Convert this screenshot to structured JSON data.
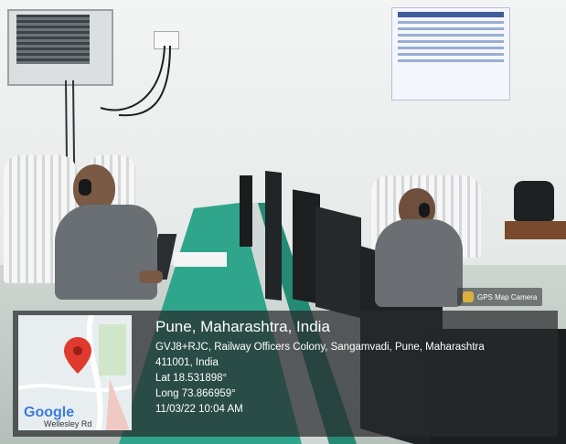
{
  "badge": {
    "label": "GPS Map Camera"
  },
  "map": {
    "brand": "Google",
    "road_label": "Wellesley Rd"
  },
  "stamp": {
    "title": "Pune, Maharashtra, India",
    "address_line1": "GVJ8+RJC, Railway Officers Colony, Sangamvadi, Pune, Maharashtra",
    "address_line2": "411001, India",
    "lat": "Lat 18.531898°",
    "long": "Long 73.866959°",
    "datetime": "11/03/22 10:04 AM"
  },
  "colors": {
    "desk": "#2fa58c",
    "suit": "#6a6f74",
    "pin": "#e03a2f",
    "overlay": "#28292c"
  }
}
